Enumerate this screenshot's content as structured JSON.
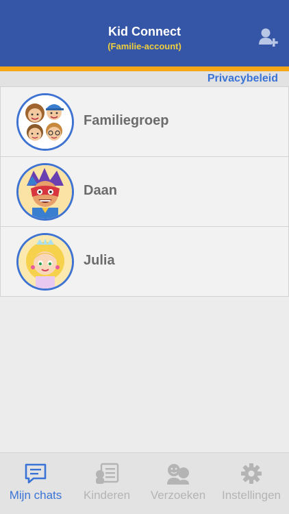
{
  "header": {
    "title": "Kid Connect",
    "subtitle": "(Familie-account)",
    "add_icon": "add-user-icon"
  },
  "privacy": {
    "label": "Privacybeleid"
  },
  "chats": [
    {
      "name": "Familiegroep",
      "avatar": "family-group-avatar"
    },
    {
      "name": "Daan",
      "avatar": "superhero-boy-avatar"
    },
    {
      "name": "Julia",
      "avatar": "princess-girl-avatar"
    }
  ],
  "tabs": [
    {
      "label": "Mijn chats",
      "icon": "chat-icon",
      "active": true
    },
    {
      "label": "Kinderen",
      "icon": "kids-list-icon",
      "active": false
    },
    {
      "label": "Verzoeken",
      "icon": "requests-icon",
      "active": false
    },
    {
      "label": "Instellingen",
      "icon": "gear-icon",
      "active": false
    }
  ],
  "colors": {
    "header": "#3556a6",
    "stripe": "#f5a817",
    "accent": "#3a73d6",
    "subtitle": "#f0cf3f",
    "inactive_tab": "#b4b4b4"
  }
}
